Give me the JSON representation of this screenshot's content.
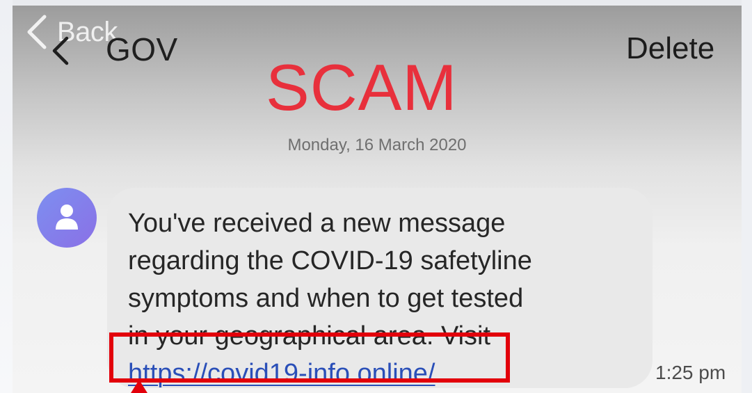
{
  "nav": {
    "back_label": "Back",
    "sender_name": "GOV",
    "delete_label": "Delete"
  },
  "annotation": {
    "scam_label": "SCAM",
    "scam_color": "#e8303c",
    "highlight_color": "#e2000b"
  },
  "conversation": {
    "date": "Monday, 16 March 2020",
    "message": {
      "text_lines": [
        "You've received a new message",
        "regarding the COVID-19 safetyline",
        "symptoms and when to get tested",
        "in your geographical area. Visit"
      ],
      "link": "https://covid19-info.online/",
      "time": "1:25 pm"
    }
  },
  "icons": {
    "back": "chevron-left-icon",
    "avatar": "person-icon"
  },
  "colors": {
    "link": "#2a4fb8",
    "avatar_start": "#7d8ff0",
    "avatar_end": "#8a70e6"
  }
}
